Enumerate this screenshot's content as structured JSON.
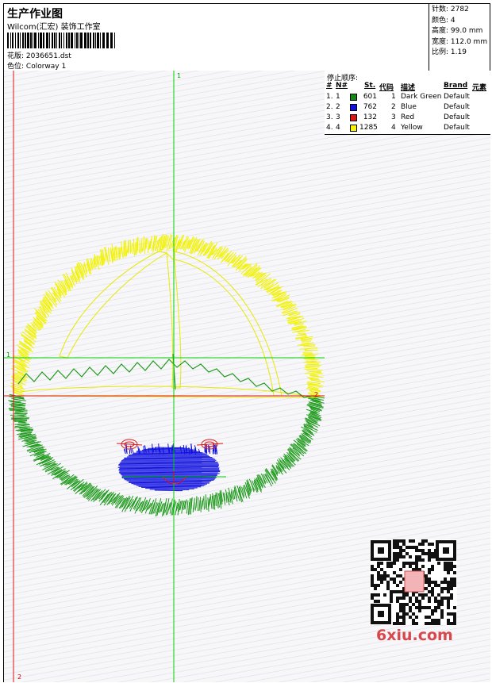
{
  "header": {
    "title": "生产作业图",
    "subtitle": "Wilcom(汇宏) 装饰工作室",
    "design_label": "花版:",
    "design_value": "2036651.dst",
    "colorway_label": "色位:",
    "colorway_value": "Colorway 1"
  },
  "stats": [
    {
      "label": "针数:",
      "value": "2782"
    },
    {
      "label": "颜色:",
      "value": "4"
    },
    {
      "label": "高度:",
      "value": "99.0 mm"
    },
    {
      "label": "宽度:",
      "value": "112.0 mm"
    },
    {
      "label": "比例:",
      "value": "1.19"
    }
  ],
  "color_table": {
    "title": "停止顺序:",
    "headers": {
      "num": "#",
      "n": "N#",
      "st": "St.",
      "code": "代码",
      "desc": "描述",
      "brand": "Brand",
      "element": "元素"
    },
    "rows": [
      {
        "num": "1.",
        "n": "1",
        "color": "#0f8a12",
        "st": "601",
        "code": "1",
        "desc": "Dark Green",
        "brand": "Default"
      },
      {
        "num": "2.",
        "n": "2",
        "color": "#1010e0",
        "st": "762",
        "code": "2",
        "desc": "Blue",
        "brand": "Default"
      },
      {
        "num": "3.",
        "n": "3",
        "color": "#e01515",
        "st": "132",
        "code": "3",
        "desc": "Red",
        "brand": "Default"
      },
      {
        "num": "4.",
        "n": "4",
        "color": "#f5f500",
        "st": "1285",
        "code": "4",
        "desc": "Yellow",
        "brand": "Default"
      }
    ]
  },
  "axis_labels": {
    "top": "1",
    "left": "1",
    "right": "2",
    "bottom": "2"
  },
  "watermark": "6xiu.com"
}
